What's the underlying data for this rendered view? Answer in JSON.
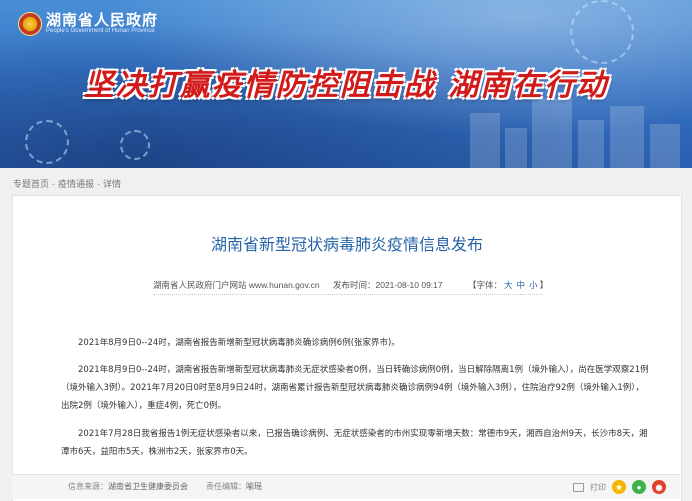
{
  "header": {
    "site_name": "湖南省人民政府",
    "site_name_en": "People's Government of Hunan Province",
    "slogan": "坚决打赢疫情防控阻击战 湖南在行动"
  },
  "breadcrumb": [
    "专题首页",
    "疫情通报",
    "详情"
  ],
  "article": {
    "title": "湖南省新型冠状病毒肺炎疫情信息发布",
    "source_site": "湖南省人民政府门户网站 www.hunan.gov.cn",
    "publish_time": "发布时间：2021-08-10 09:17",
    "font_label_prefix": "【字体：",
    "font_large": "大",
    "font_medium": "中",
    "font_small": "小",
    "font_label_suffix": "】",
    "paragraphs": [
      "2021年8月9日0--24时，湖南省报告新增新型冠状病毒肺炎确诊病例6例(张家界市)。",
      "2021年8月9日0--24时，湖南省报告新增新型冠状病毒肺炎无症状感染者0例，当日转确诊病例0例，当日解除隔离1例（境外输入），尚在医学观察21例（境外输入3例）。2021年7月20日0时至8月9日24时，湖南省累计报告新型冠状病毒肺炎确诊病例94例（境外输入3例），住院治疗92例（境外输入1例），出院2例（境外输入），重症4例，死亡0例。",
      "2021年7月28日我省报告1例无症状感染者以来，已报告确诊病例、无症状感染者的市州实现零新增天数：常德市9天，湘西自治州9天，长沙市8天，湘潭市6天，益阳市5天，株洲市2天，张家界市0天。"
    ]
  },
  "footer": {
    "source_label": "信息来源：",
    "source_value": "湖南省卫生健康委员会",
    "editor_label": "责任编辑：",
    "editor_value": "喻瑶",
    "print_label": "打印"
  },
  "colors": {
    "title_blue": "#2563a8",
    "slogan_red": "#d11a1a",
    "banner_blue": "#3573c4"
  },
  "icons": [
    "emblem-logo-icon",
    "print-icon",
    "qzone-share-icon",
    "wechat-share-icon",
    "weibo-share-icon"
  ]
}
